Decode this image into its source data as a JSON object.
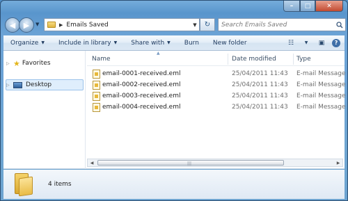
{
  "window": {
    "caption_min": "–",
    "caption_max": "□",
    "caption_close": "✕"
  },
  "address": {
    "back_glyph": "◀",
    "forward_glyph": "▶",
    "separator": "▶",
    "path": "Emails Saved",
    "refresh_glyph": "↻",
    "search_placeholder": "Search Emails Saved"
  },
  "toolbar": {
    "items": [
      {
        "label": "Organize",
        "dropdown": true
      },
      {
        "label": "Include in library",
        "dropdown": true
      },
      {
        "label": "Share with",
        "dropdown": true
      },
      {
        "label": "Burn",
        "dropdown": false
      },
      {
        "label": "New folder",
        "dropdown": false
      }
    ],
    "dropdown_glyph": "▼",
    "views_glyph": "☷",
    "preview_glyph": "▣",
    "help_glyph": "?"
  },
  "navigation": {
    "favorites_label": "Favorites",
    "desktop_label": "Desktop",
    "expand_glyph": "▷"
  },
  "columns": {
    "name": "Name",
    "date": "Date modified",
    "type": "Type"
  },
  "files": [
    {
      "name": "email-0001-received.eml",
      "date": "25/04/2011 11:43",
      "type": "E-mail Message"
    },
    {
      "name": "email-0002-received.eml",
      "date": "25/04/2011 11:43",
      "type": "E-mail Message"
    },
    {
      "name": "email-0003-received.eml",
      "date": "25/04/2011 11:43",
      "type": "E-mail Message"
    },
    {
      "name": "email-0004-received.eml",
      "date": "25/04/2011 11:43",
      "type": "E-mail Message"
    }
  ],
  "scrollbar": {
    "left_glyph": "◀",
    "right_glyph": "▶",
    "grip": "|||"
  },
  "details": {
    "item_count": "4 items"
  },
  "colors": {
    "selection": "#dfeefc",
    "accent": "#2a5a8a"
  }
}
